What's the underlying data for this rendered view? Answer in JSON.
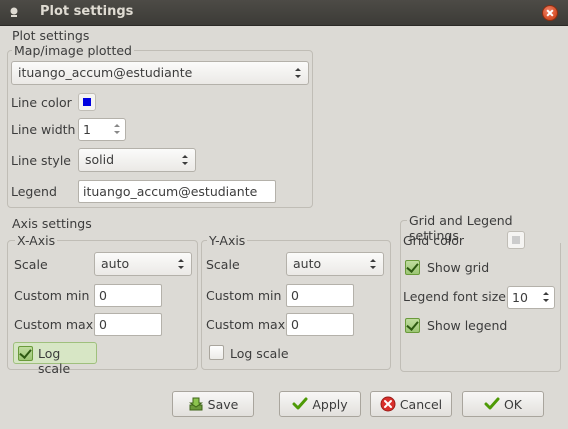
{
  "window": {
    "title": "Plot settings"
  },
  "plot_settings": {
    "heading": "Plot settings",
    "map_group_label": "Map/image plotted",
    "map_value": "ituango_accum@estudiante",
    "line_color_label": "Line color",
    "line_color": "#0000e0",
    "line_width_label": "Line width",
    "line_width_value": "1",
    "line_style_label": "Line style",
    "line_style_value": "solid",
    "legend_label": "Legend",
    "legend_value": "ituango_accum@estudiante"
  },
  "axis_settings": {
    "heading": "Axis settings",
    "x": {
      "label": "X-Axis",
      "scale_label": "Scale",
      "scale_value": "auto",
      "custom_min_label": "Custom min",
      "custom_min_value": "0",
      "custom_max_label": "Custom max",
      "custom_max_value": "0",
      "log_scale_label": "Log scale",
      "log_scale_checked": true
    },
    "y": {
      "label": "Y-Axis",
      "scale_label": "Scale",
      "scale_value": "auto",
      "custom_min_label": "Custom min",
      "custom_min_value": "0",
      "custom_max_label": "Custom max",
      "custom_max_value": "0",
      "log_scale_label": "Log scale",
      "log_scale_checked": false
    }
  },
  "grid_legend": {
    "heading": "Grid and Legend settings",
    "grid_color_label": "Grid color",
    "grid_color": "#cccccc",
    "show_grid_label": "Show grid",
    "show_grid_checked": true,
    "legend_font_size_label": "Legend font size",
    "legend_font_size_value": "10",
    "show_legend_label": "Show legend",
    "show_legend_checked": true
  },
  "buttons": {
    "save": "Save",
    "apply": "Apply",
    "cancel": "Cancel",
    "ok": "OK"
  }
}
